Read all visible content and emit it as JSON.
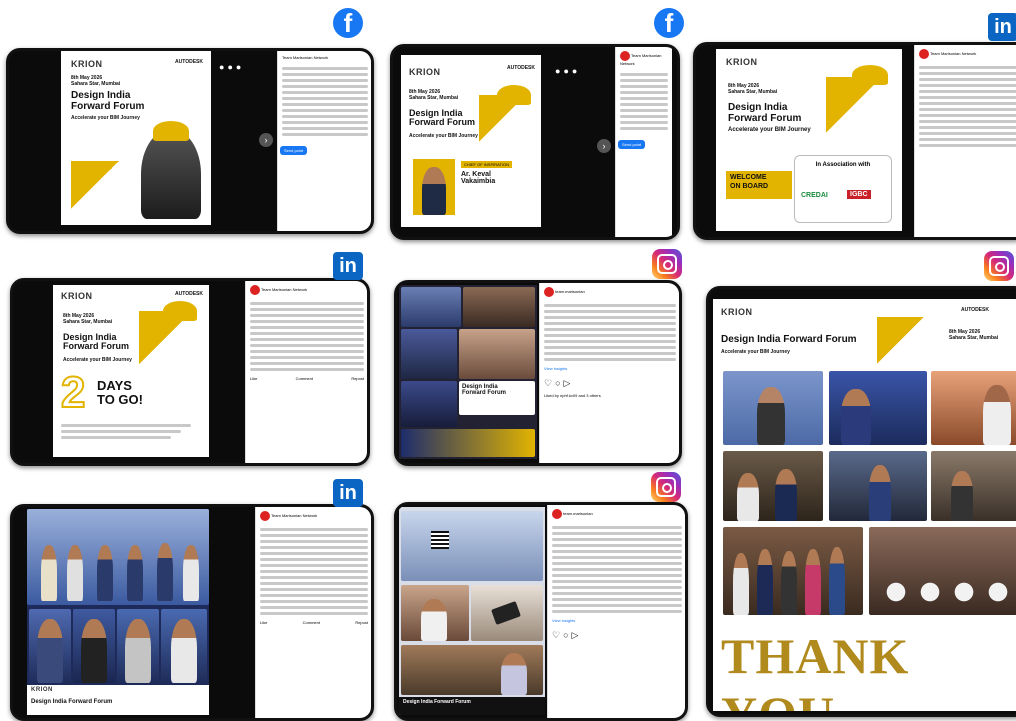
{
  "brand": {
    "krion": "KRION",
    "autodesk": "AUTODESK"
  },
  "event": {
    "date": "8th May 2026",
    "venue": "Sahara Star, Mumbai",
    "title_line1": "Design India",
    "title_line2": "Forward Forum",
    "title_full": "Design India Forward Forum",
    "tagline": "Accelerate your BIM Journey"
  },
  "speaker": {
    "tag": "CHIEF OF INSPIRATION",
    "name_line1": "Ar. Keval",
    "name_line2": "Vakaimbia"
  },
  "welcome": {
    "line1": "WELCOME",
    "line2": "ON BOARD",
    "assoc": "In Association with",
    "partner1": "CREDAI",
    "partner2": "IGBC"
  },
  "countdown": {
    "number": "2",
    "line1": "DAYS",
    "line2": "TO GO!"
  },
  "page": {
    "author": "Team Marlsonian Network",
    "ig_author": "team.marlsonian"
  },
  "actions": {
    "send": "Send point",
    "like": "Like",
    "comment": "Comment",
    "repost": "Repost"
  },
  "thankyou": {
    "forum": "Design India Forward Forum",
    "tagline": "Accelerate your BIM Journey",
    "date": "8th May 2026",
    "venue": "Sahara Star, Mumbai",
    "closing": "THANK YOU"
  },
  "badges": {
    "fb": "f",
    "li": "in"
  },
  "ig_misc": {
    "view_insights": "View insights",
    "likes": "Liked by nphf.kv09 and 3 others"
  },
  "colors": {
    "accent": "#e2b400",
    "facebook": "#1877f2",
    "linkedin": "#0a66c2",
    "ink": "#111111"
  }
}
